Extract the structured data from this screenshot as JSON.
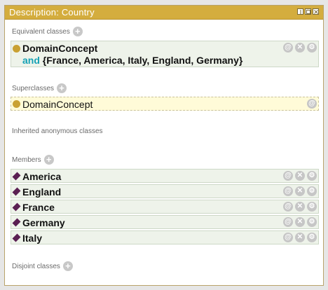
{
  "window": {
    "title": "Description: Country"
  },
  "sections": {
    "equivalent": {
      "label": "Equivalent classes",
      "item": {
        "name": "DomainConcept",
        "keyword": "and",
        "expression": " {France, America, Italy, England, Germany}"
      }
    },
    "superclasses": {
      "label": "Superclasses",
      "item": {
        "name": "DomainConcept"
      }
    },
    "inherited": {
      "label": "Inherited anonymous classes"
    },
    "members": {
      "label": "Members",
      "items": [
        "America",
        "England",
        "France",
        "Germany",
        "Italy"
      ]
    },
    "disjoint": {
      "label": "Disjoint classes"
    }
  },
  "icons": {
    "add": "+",
    "annotate": "@",
    "delete": "✕",
    "edit": "⚙"
  },
  "colors": {
    "titlebar": "#d4ad3e",
    "class_dot": "#c9a133",
    "individual_diamond": "#5a1f52",
    "keyword": "#17a2b6"
  }
}
